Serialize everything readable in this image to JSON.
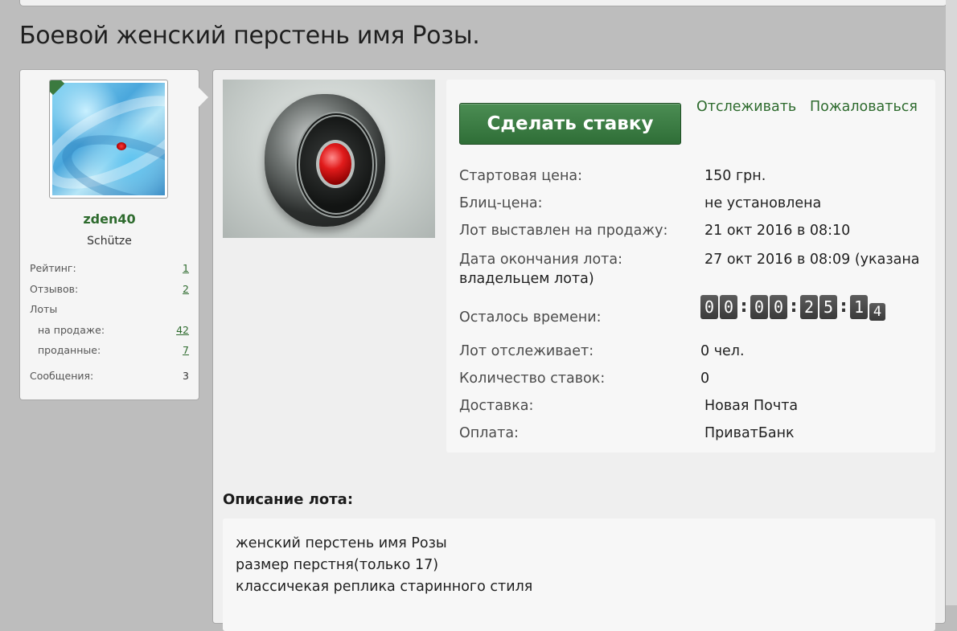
{
  "page": {
    "title": "Боевой женский перстень имя Розы."
  },
  "seller": {
    "username": "zden40",
    "title": "Schütze",
    "stats": {
      "rating_label": "Рейтинг:",
      "rating_value": "1",
      "reviews_label": "Отзывов:",
      "reviews_value": "2",
      "lots_label": "Лоты",
      "on_sale_label": "на продаже:",
      "on_sale_value": "42",
      "sold_label": "проданные:",
      "sold_value": "7",
      "messages_label": "Сообщения:",
      "messages_value": "3"
    }
  },
  "lot": {
    "bid_button": "Сделать ставку",
    "watch_link": "Отслеживать",
    "report_link": "Пожаловаться",
    "start_price_label": "Стартовая цена:",
    "start_price_value": "150 грн.",
    "blitz_label": "Блиц-цена:",
    "blitz_value": "не установлена",
    "listed_label": "Лот выставлен на продажу:",
    "listed_value": "21 окт 2016 в 08:10",
    "end_label": "Дата окончания лота:",
    "end_value": "27 окт 2016 в 08:09 (указана",
    "end_value_tail": "владельцем лота)",
    "remaining_label": "Осталось времени:",
    "timer": {
      "d1": "0",
      "d2": "0",
      "d3": "0",
      "d4": "0",
      "d5": "2",
      "d6": "5",
      "d7": "1",
      "d8": "4"
    },
    "watchers_label": "Лот отслеживает:",
    "watchers_value": "0 чел.",
    "bids_label": "Количество ставок:",
    "bids_value": "0",
    "delivery_label": "Доставка:",
    "delivery_value": "Новая Почта",
    "payment_label": "Оплата:",
    "payment_value": "ПриватБанк"
  },
  "description": {
    "heading": "Описание лота:",
    "lines": [
      "женский перстень имя Розы",
      "размер перстня(только 17)",
      "классичекая реплика старинного стиля"
    ]
  }
}
